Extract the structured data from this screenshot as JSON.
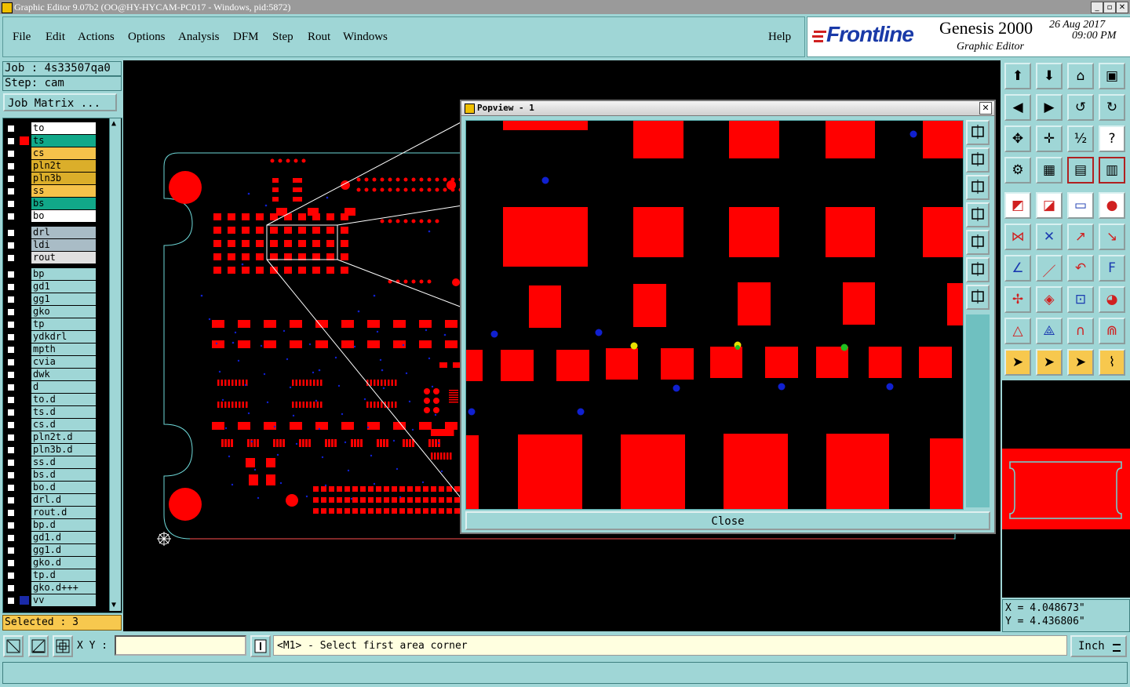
{
  "window": {
    "title": "Graphic Editor 9.07b2 (OO@HY-HYCAM-PC017 - Windows, pid:5872)"
  },
  "menu": {
    "items": [
      "File",
      "Edit",
      "Actions",
      "Options",
      "Analysis",
      "DFM",
      "Step",
      "Rout",
      "Windows"
    ],
    "help": "Help"
  },
  "brand": {
    "logo": "Frontline",
    "product": "Genesis 2000",
    "subtitle": "Graphic Editor",
    "date": "26 Aug 2017",
    "time": "09:00 PM"
  },
  "job": {
    "job_label": "Job : 4s33507qa0",
    "step_label": "Step: cam",
    "matrix_button": "Job Matrix ..."
  },
  "layers": {
    "group1": [
      {
        "name": "to",
        "color": "#ffffff"
      },
      {
        "name": "ts",
        "color": "#11a889"
      },
      {
        "name": "cs",
        "color": "#f5c24a"
      },
      {
        "name": "pln2t",
        "color": "#dbae2a"
      },
      {
        "name": "pln3b",
        "color": "#dbae2a"
      },
      {
        "name": "ss",
        "color": "#f5c24a"
      },
      {
        "name": "bs",
        "color": "#11a889"
      },
      {
        "name": "bo",
        "color": "#ffffff"
      }
    ],
    "group2": [
      {
        "name": "drl",
        "color": "#a9bcc6"
      },
      {
        "name": "ldi",
        "color": "#a9bcc6"
      },
      {
        "name": "rout",
        "color": "#e0e0e0"
      }
    ],
    "group3": [
      "bp",
      "gd1",
      "gg1",
      "gko",
      "tp",
      "ydkdrl",
      "mpth",
      "cvia",
      "dwk",
      "d",
      "to.d",
      "ts.d",
      "cs.d",
      "pln2t.d",
      "pln3b.d",
      "ss.d",
      "bs.d",
      "bo.d",
      "drl.d",
      "rout.d",
      "bp.d",
      "gd1.d",
      "gg1.d",
      "gko.d",
      "tp.d",
      "gko.d+++",
      "vv"
    ],
    "selected": "Selected : 3"
  },
  "popview": {
    "title": "Popview - 1",
    "close_button": "Close"
  },
  "coords": {
    "x": "X = 4.048673\"",
    "y": "Y = 4.436806\""
  },
  "statusbar": {
    "xy_label": "X Y :",
    "xy_value": "",
    "prompt": "<M1> - Select first area corner",
    "units": "Inch"
  },
  "colors": {
    "panel": "#9fd6d6",
    "pad": "#ff0000",
    "via": "#1020d0",
    "highlight_yellow": "#e8e000",
    "highlight_green": "#20c020"
  },
  "toolbar_icons": [
    "zoom-home-icon",
    "zoom-in-icon",
    "home-icon",
    "window-icon",
    "pan-left-icon",
    "pan-right-icon",
    "undo-view-icon",
    "redraw-icon",
    "fit-icon",
    "center-icon",
    "scale-1-2-icon",
    "help-icon",
    "snap-icon",
    "grid-icon",
    "layers-icon",
    "layers-alt-icon",
    "add-pad-icon",
    "add-line-icon",
    "measure-icon",
    "add-circle-icon",
    "connect-icon",
    "delete-icon",
    "move-icon",
    "copy-icon",
    "angle-icon",
    "line-icon",
    "arc-icon",
    "text-icon",
    "select-icon",
    "resize-icon",
    "measure-area-icon",
    "shape-icon",
    "triangle-icon",
    "triangle-alt-icon",
    "arch-icon",
    "arch-alt-icon",
    "pointer-icon",
    "pointer-alt-icon",
    "pointer-sel-icon",
    "route-icon"
  ]
}
